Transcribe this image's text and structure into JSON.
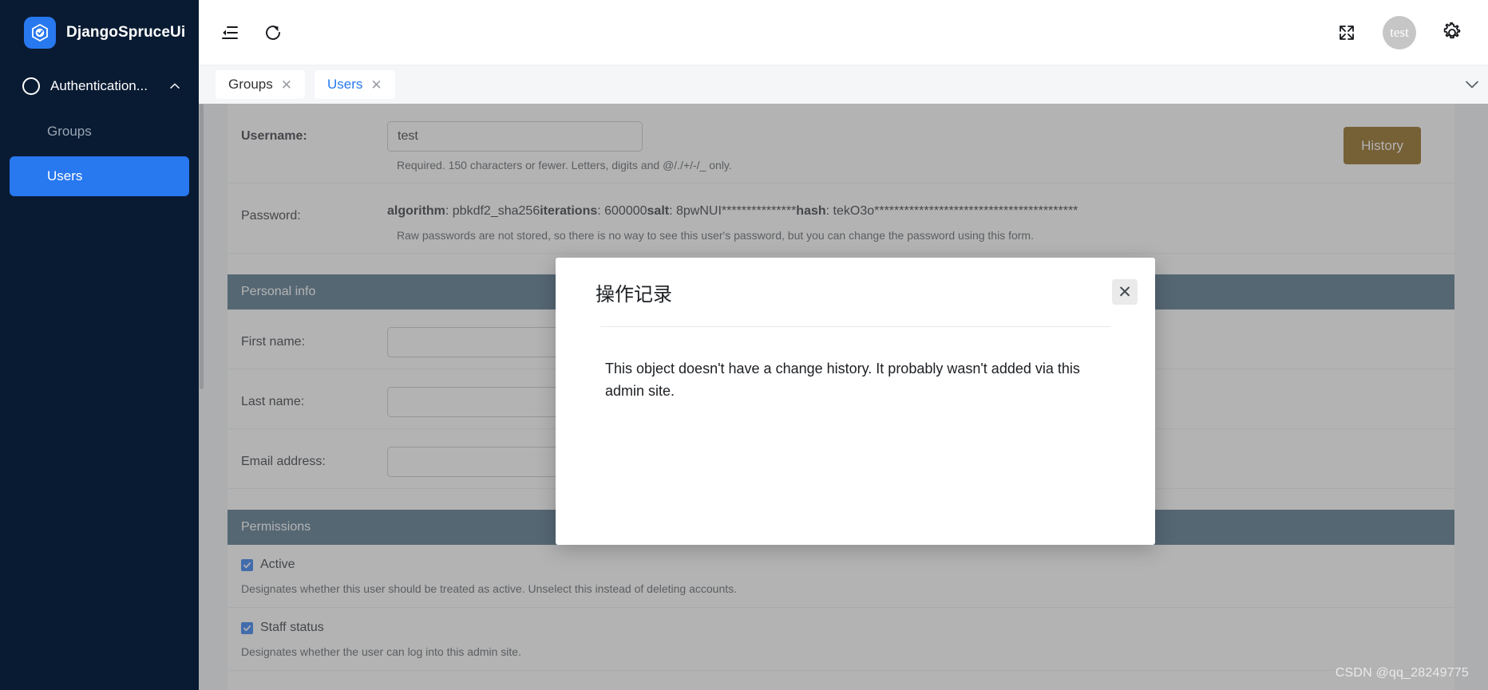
{
  "brand": {
    "name": "DjangoSpruceUi",
    "logo_icon": "spruce-hexagon-logo-icon",
    "logo_color": "#2878f0"
  },
  "sidebar": {
    "group": {
      "label": "Authentication...",
      "circle_icon": "circle-outline-icon",
      "caret_icon": "chevron-up-icon",
      "expanded": true
    },
    "items": [
      {
        "label": "Groups",
        "active": false
      },
      {
        "label": "Users",
        "active": true
      }
    ],
    "background": "#091b32",
    "active_color": "#2878f0"
  },
  "topbar": {
    "collapse_icon": "menu-collapse-icon",
    "refresh_icon": "refresh-icon",
    "fullscreen_icon": "fullscreen-expand-icon",
    "avatar_label": "test",
    "settings_icon": "gear-icon"
  },
  "tabbar": {
    "tabs": [
      {
        "label": "Groups",
        "close_icon": "close-icon",
        "active": false
      },
      {
        "label": "Users",
        "close_icon": "close-icon",
        "active": true
      }
    ],
    "overflow_icon": "chevron-down-icon"
  },
  "form": {
    "history_button": "History",
    "history_color": "#8a6010",
    "username": {
      "label": "Username:",
      "value": "test",
      "placeholder": "",
      "help": "Required. 150 characters or fewer. Letters, digits and @/./+/-/_ only."
    },
    "password": {
      "label": "Password:",
      "algorithm_key": "algorithm",
      "algorithm_value": ": pbkdf2_sha256",
      "iterations_key": "iterations",
      "iterations_value": ": 600000",
      "salt_key": "salt",
      "salt_value": ": 8pwNUI***************",
      "hash_key": "hash",
      "hash_value": ": tekO3o*****************************************",
      "help": "Raw passwords are not stored, so there is no way to see this user's password, but you can change the password using this form."
    },
    "personal_info": {
      "header": "Personal info",
      "header_color": "#4c6d85",
      "fields": [
        {
          "label": "First name:",
          "value": ""
        },
        {
          "label": "Last name:",
          "value": ""
        },
        {
          "label": "Email address:",
          "value": ""
        }
      ]
    },
    "permissions": {
      "header": "Permissions",
      "header_color": "#4c6d85",
      "checks": [
        {
          "label": "Active",
          "checked": true,
          "help": "Designates whether this user should be treated as active. Unselect this instead of deleting accounts."
        },
        {
          "label": "Staff status",
          "checked": true,
          "help": "Designates whether the user can log into this admin site."
        }
      ]
    }
  },
  "modal": {
    "title": "操作记录",
    "close_icon": "close-icon",
    "body": "This object doesn't have a change history. It probably wasn't added via this admin site."
  },
  "watermark": "CSDN @qq_28249775"
}
